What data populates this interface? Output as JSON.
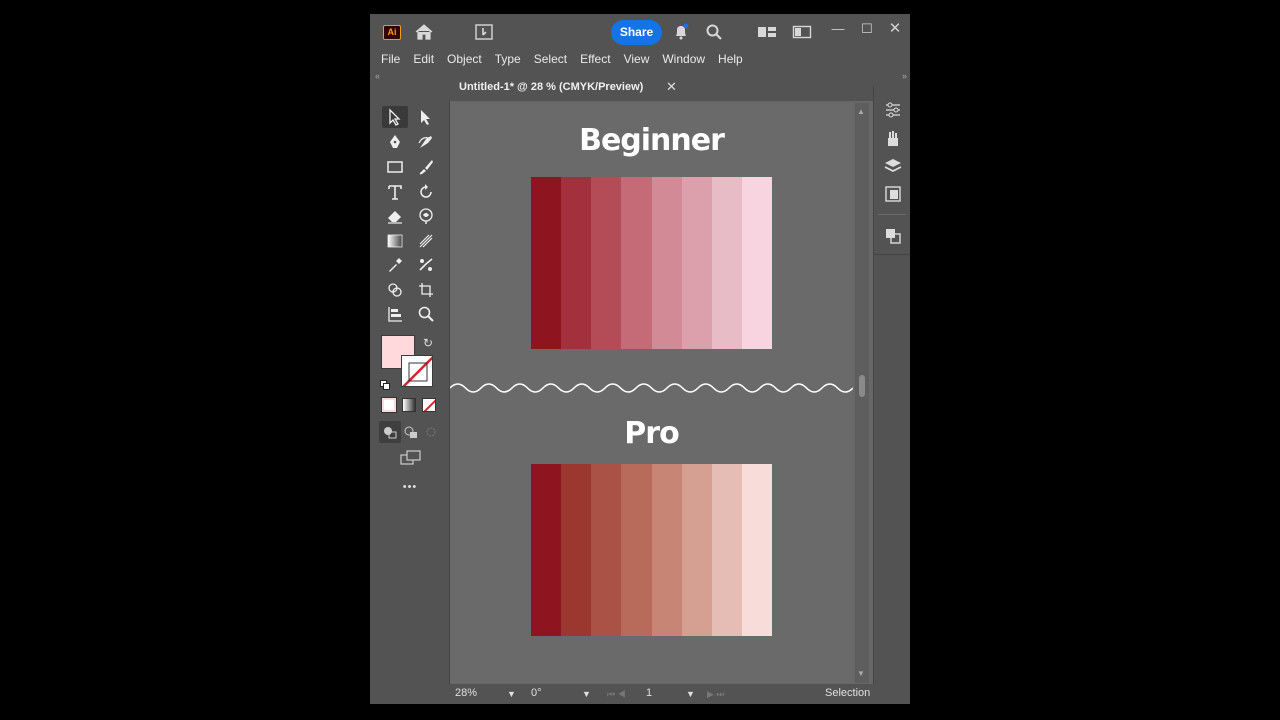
{
  "app": {
    "logo": "Ai",
    "share_label": "Share",
    "menu": [
      "File",
      "Edit",
      "Object",
      "Type",
      "Select",
      "Effect",
      "View",
      "Window",
      "Help"
    ]
  },
  "document": {
    "tab_title": "Untitled-1* @ 28 % (CMYK/Preview)",
    "tab_close": "✕"
  },
  "artboard": {
    "beginner_title": "Beginner",
    "pro_title": "Pro",
    "beginner_colors": [
      "#8e1520",
      "#a3303d",
      "#b34c57",
      "#c46b77",
      "#d18a96",
      "#dba0ab",
      "#e8bcc6",
      "#f7d4df"
    ],
    "pro_colors": [
      "#8e1520",
      "#9c3730",
      "#ab5246",
      "#b96b5b",
      "#c78575",
      "#d59f92",
      "#e5bdb4",
      "#f8dcd9"
    ]
  },
  "toolbar": {
    "fill_color": "#ffd9dc",
    "more_label": "•••"
  },
  "status": {
    "zoom": "28%",
    "rotation": "0°",
    "artboard_number": "1",
    "mode": "Selection"
  },
  "icons": {
    "home": "home-icon",
    "bell": "bell-icon",
    "search": "search-icon",
    "arrange": "arrange-documents-icon",
    "panels": "panels-icon"
  }
}
